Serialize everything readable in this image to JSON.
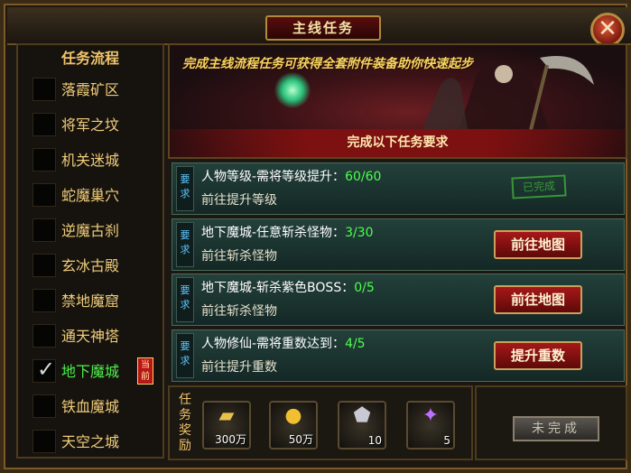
{
  "window": {
    "title": "主线任务"
  },
  "left_panel": {
    "title": "任务流程",
    "steps": [
      {
        "label": "落霞矿区",
        "checked": false
      },
      {
        "label": "将军之坟",
        "checked": false
      },
      {
        "label": "机关迷城",
        "checked": false
      },
      {
        "label": "蛇魔巢穴",
        "checked": false
      },
      {
        "label": "逆魔古刹",
        "checked": false
      },
      {
        "label": "玄冰古殿",
        "checked": false
      },
      {
        "label": "禁地魔窟",
        "checked": false
      },
      {
        "label": "通天神塔",
        "checked": false
      },
      {
        "label": "地下魔城",
        "checked": true,
        "current": true
      },
      {
        "label": "铁血魔城",
        "checked": false
      },
      {
        "label": "天空之城",
        "checked": false
      }
    ],
    "current_badge": "当前",
    "check_glyph": "✓"
  },
  "banner": {
    "headline": "完成主线流程任务可获得全套附件装备助你快速起步",
    "subheading": "完成以下任务要求"
  },
  "requirement_tag": "要求",
  "quests": [
    {
      "name": "人物等级-需将等级提升：",
      "progress": "60/60",
      "hint": "前往提升等级",
      "action": "已完成",
      "done": true
    },
    {
      "name": "地下魔城-任意斩杀怪物：",
      "progress": "3/30",
      "hint": "前往斩杀怪物",
      "action": "前往地图",
      "done": false
    },
    {
      "name": "地下魔城-斩杀紫色BOSS：",
      "progress": "0/5",
      "hint": "前往斩杀怪物",
      "action": "前往地图",
      "done": false
    },
    {
      "name": "人物修仙-需将重数达到：",
      "progress": "4/5",
      "hint": "前往提升重数",
      "action": "提升重数",
      "done": false
    }
  ],
  "rewards": {
    "label": "任务奖励",
    "items": [
      {
        "icon": "gold-ingot-icon",
        "count": "300万"
      },
      {
        "icon": "gold-coins-icon",
        "count": "50万"
      },
      {
        "icon": "potion-bag-icon",
        "count": "10"
      },
      {
        "icon": "purple-orb-icon",
        "count": "5"
      }
    ]
  },
  "status_button": "未完成",
  "close_glyph": "✕",
  "colors": {
    "accent_gold": "#f0c36a",
    "progress_green": "#4cff4c",
    "button_red": "#a51818"
  }
}
